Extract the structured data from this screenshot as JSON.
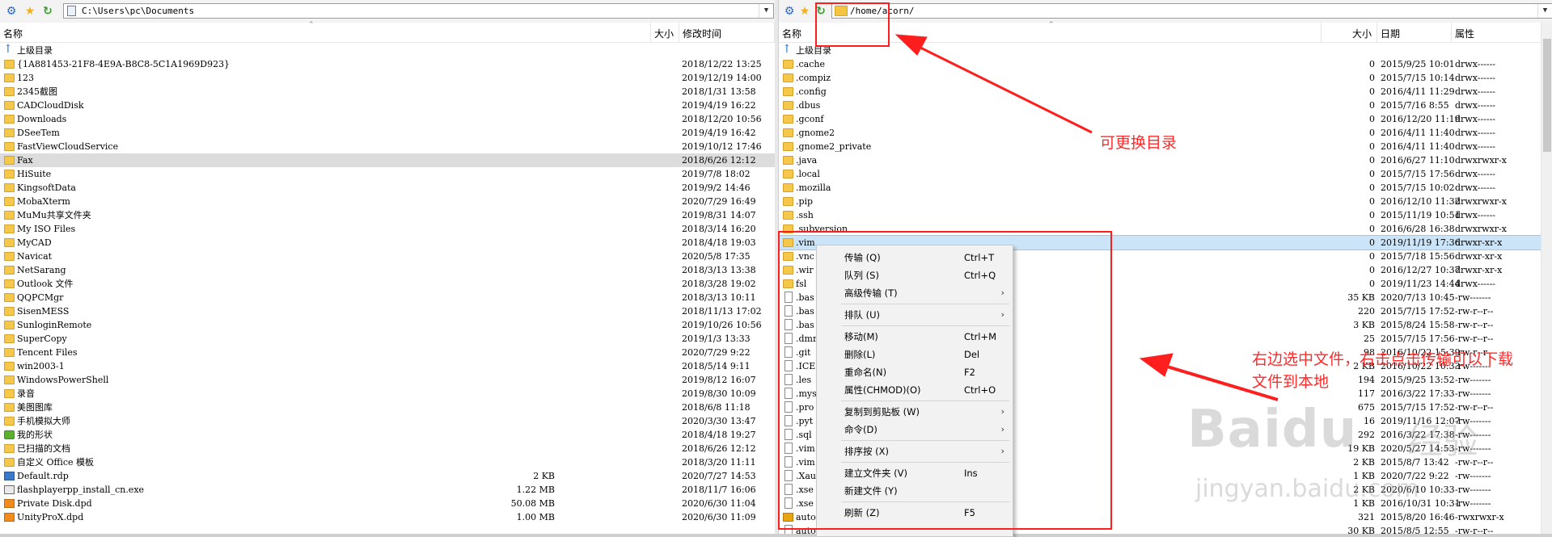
{
  "left": {
    "path": "C:\\Users\\pc\\Documents",
    "columns": {
      "name": "名称",
      "size": "大小",
      "date": "修改时间"
    },
    "rows": [
      {
        "icon": "up",
        "name": "上级目录",
        "size": "",
        "date": ""
      },
      {
        "icon": "folder",
        "name": "{1A881453-21F8-4E9A-B8C8-5C1A1969D923}",
        "size": "",
        "date": "2018/12/22 13:25"
      },
      {
        "icon": "folder",
        "name": "123",
        "size": "",
        "date": "2019/12/19 14:00"
      },
      {
        "icon": "folder",
        "name": "2345截图",
        "size": "",
        "date": "2018/1/31 13:58"
      },
      {
        "icon": "folder",
        "name": "CADCloudDisk",
        "size": "",
        "date": "2019/4/19 16:22"
      },
      {
        "icon": "folder",
        "name": "Downloads",
        "size": "",
        "date": "2018/12/20 10:56"
      },
      {
        "icon": "folder",
        "name": "DSeeTem",
        "size": "",
        "date": "2019/4/19 16:42"
      },
      {
        "icon": "folder",
        "name": "FastViewCloudService",
        "size": "",
        "date": "2019/10/12 17:46"
      },
      {
        "icon": "folder",
        "name": "Fax",
        "size": "",
        "date": "2018/6/26 12:12",
        "selected": true
      },
      {
        "icon": "folder",
        "name": "HiSuite",
        "size": "",
        "date": "2019/7/8 18:02"
      },
      {
        "icon": "folder",
        "name": "KingsoftData",
        "size": "",
        "date": "2019/9/2 14:46"
      },
      {
        "icon": "folder",
        "name": "MobaXterm",
        "size": "",
        "date": "2020/7/29 16:49"
      },
      {
        "icon": "folder",
        "name": "MuMu共享文件夹",
        "size": "",
        "date": "2019/8/31 14:07"
      },
      {
        "icon": "folder",
        "name": "My ISO Files",
        "size": "",
        "date": "2018/3/14 16:20"
      },
      {
        "icon": "folder",
        "name": "MyCAD",
        "size": "",
        "date": "2018/4/18 19:03"
      },
      {
        "icon": "folder",
        "name": "Navicat",
        "size": "",
        "date": "2020/5/8 17:35"
      },
      {
        "icon": "folder",
        "name": "NetSarang",
        "size": "",
        "date": "2018/3/13 13:38"
      },
      {
        "icon": "folder",
        "name": "Outlook 文件",
        "size": "",
        "date": "2018/3/28 19:02"
      },
      {
        "icon": "folder",
        "name": "QQPCMgr",
        "size": "",
        "date": "2018/3/13 10:11"
      },
      {
        "icon": "folder",
        "name": "SisenMESS",
        "size": "",
        "date": "2018/11/13 17:02"
      },
      {
        "icon": "folder",
        "name": "SunloginRemote",
        "size": "",
        "date": "2019/10/26 10:56"
      },
      {
        "icon": "folder",
        "name": "SuperCopy",
        "size": "",
        "date": "2019/1/3 13:33"
      },
      {
        "icon": "folder",
        "name": "Tencent Files",
        "size": "",
        "date": "2020/7/29 9:22"
      },
      {
        "icon": "folder",
        "name": "win2003-1",
        "size": "",
        "date": "2018/5/14 9:11"
      },
      {
        "icon": "folder",
        "name": "WindowsPowerShell",
        "size": "",
        "date": "2019/8/12 16:07"
      },
      {
        "icon": "folder",
        "name": "录音",
        "size": "",
        "date": "2019/8/30 10:09"
      },
      {
        "icon": "folder",
        "name": "美图图库",
        "size": "",
        "date": "2018/6/8 11:18"
      },
      {
        "icon": "folder",
        "name": "手机模拟大师",
        "size": "",
        "date": "2020/3/30 13:47"
      },
      {
        "icon": "shape",
        "name": "我的形状",
        "size": "",
        "date": "2018/4/18 19:27"
      },
      {
        "icon": "folder",
        "name": "已扫描的文档",
        "size": "",
        "date": "2018/6/26 12:12"
      },
      {
        "icon": "folder",
        "name": "自定义 Office 模板",
        "size": "",
        "date": "2018/3/20 11:11"
      },
      {
        "icon": "rdp",
        "name": "Default.rdp",
        "size": "2 KB",
        "date": "2020/7/27 14:53"
      },
      {
        "icon": "exe",
        "name": "flashplayerpp_install_cn.exe",
        "size": "1.22 MB",
        "date": "2018/11/7 16:06"
      },
      {
        "icon": "dpd",
        "name": "Private Disk.dpd",
        "size": "50.08 MB",
        "date": "2020/6/30 11:04"
      },
      {
        "icon": "dpd",
        "name": "UnityProX.dpd",
        "size": "1.00 MB",
        "date": "2020/6/30 11:09"
      }
    ]
  },
  "right": {
    "path": "/home/acorn/",
    "columns": {
      "name": "名称",
      "size": "大小",
      "date": "日期",
      "perm": "属性"
    },
    "rows": [
      {
        "icon": "up",
        "name": "上级目录",
        "size": "",
        "date": "",
        "perm": ""
      },
      {
        "icon": "folder",
        "name": ".cache",
        "size": "0",
        "date": "2015/9/25 10:01",
        "perm": "drwx------"
      },
      {
        "icon": "folder",
        "name": ".compiz",
        "size": "0",
        "date": "2015/7/15 10:14",
        "perm": "drwx------"
      },
      {
        "icon": "folder",
        "name": ".config",
        "size": "0",
        "date": "2016/4/11 11:29",
        "perm": "drwx------"
      },
      {
        "icon": "folder",
        "name": ".dbus",
        "size": "0",
        "date": "2015/7/16 8:55",
        "perm": "drwx------"
      },
      {
        "icon": "folder",
        "name": ".gconf",
        "size": "0",
        "date": "2016/12/20 11:19",
        "perm": "drwx------"
      },
      {
        "icon": "folder",
        "name": ".gnome2",
        "size": "0",
        "date": "2016/4/11 11:40",
        "perm": "drwx------"
      },
      {
        "icon": "folder",
        "name": ".gnome2_private",
        "size": "0",
        "date": "2016/4/11 11:40",
        "perm": "drwx------"
      },
      {
        "icon": "folder",
        "name": ".java",
        "size": "0",
        "date": "2016/6/27 11:10",
        "perm": "drwxrwxr-x"
      },
      {
        "icon": "folder",
        "name": ".local",
        "size": "0",
        "date": "2015/7/15 17:56",
        "perm": "drwx------"
      },
      {
        "icon": "folder",
        "name": ".mozilla",
        "size": "0",
        "date": "2015/7/15 10:02",
        "perm": "drwx------"
      },
      {
        "icon": "folder",
        "name": ".pip",
        "size": "0",
        "date": "2016/12/10 11:32",
        "perm": "drwxrwxr-x"
      },
      {
        "icon": "folder",
        "name": ".ssh",
        "size": "0",
        "date": "2015/11/19 10:51",
        "perm": "drwx------"
      },
      {
        "icon": "folder",
        "name": ".subversion",
        "size": "0",
        "date": "2016/6/28 16:38",
        "perm": "drwxrwxr-x"
      },
      {
        "icon": "folder",
        "name": ".vim",
        "size": "0",
        "date": "2019/11/19 17:36",
        "perm": "drwxr-xr-x",
        "selected": true
      },
      {
        "icon": "folder",
        "name": ".vnc",
        "size": "0",
        "date": "2015/7/18 15:56",
        "perm": "drwxr-xr-x"
      },
      {
        "icon": "folder",
        "name": ".wir",
        "size": "0",
        "date": "2016/12/27 10:37",
        "perm": "drwxr-xr-x"
      },
      {
        "icon": "folder",
        "name": "fsl",
        "size": "0",
        "date": "2019/11/23 14:44",
        "perm": "drwx------"
      },
      {
        "icon": "file",
        "name": ".bas",
        "size": "35 KB",
        "date": "2020/7/13 10:45",
        "perm": "-rw-------"
      },
      {
        "icon": "file",
        "name": ".bas",
        "size": "220",
        "date": "2015/7/15 17:52",
        "perm": "-rw-r--r--"
      },
      {
        "icon": "file",
        "name": ".bas",
        "size": "3 KB",
        "date": "2015/8/24 15:58",
        "perm": "-rw-r--r--"
      },
      {
        "icon": "file",
        "name": ".dmr",
        "size": "25",
        "date": "2015/7/15 17:56",
        "perm": "-rw-r--r--"
      },
      {
        "icon": "file",
        "name": ".git",
        "size": "98",
        "date": "2016/10/22 15:39",
        "perm": "-rw-r--r--"
      },
      {
        "icon": "file",
        "name": ".ICE",
        "size": "2 KB",
        "date": "2016/10/22 10:33",
        "perm": "-rw-------"
      },
      {
        "icon": "file",
        "name": ".les",
        "size": "194",
        "date": "2015/9/25 13:52",
        "perm": "-rw-------"
      },
      {
        "icon": "file",
        "name": ".mys",
        "size": "117",
        "date": "2016/3/22 17:33",
        "perm": "-rw-------"
      },
      {
        "icon": "file",
        "name": ".pro",
        "size": "675",
        "date": "2015/7/15 17:52",
        "perm": "-rw-r--r--"
      },
      {
        "icon": "file",
        "name": ".pyt",
        "size": "16",
        "date": "2019/11/16 12:07",
        "perm": "-rw-------"
      },
      {
        "icon": "file",
        "name": ".sql",
        "size": "292",
        "date": "2016/3/22 17:38",
        "perm": "-rw-------"
      },
      {
        "icon": "file",
        "name": ".vim",
        "size": "19 KB",
        "date": "2020/5/27 14:53",
        "perm": "-rw-------"
      },
      {
        "icon": "file",
        "name": ".vim",
        "size": "2 KB",
        "date": "2015/8/7 13:42",
        "perm": "-rw-r--r--"
      },
      {
        "icon": "file",
        "name": ".Xau",
        "size": "1 KB",
        "date": "2020/7/22 9:22",
        "perm": "-rw-------"
      },
      {
        "icon": "file",
        "name": ".xse",
        "size": "2 KB",
        "date": "2020/6/10 10:33",
        "perm": "-rw-------"
      },
      {
        "icon": "file",
        "name": ".xse",
        "size": "1 KB",
        "date": "2016/10/31 10:31",
        "perm": "-rw-------"
      },
      {
        "icon": "sh",
        "name": "auto",
        "size": "321",
        "date": "2015/8/20 16:46",
        "perm": "-rwxrwxr-x"
      },
      {
        "icon": "file",
        "name": "auto",
        "size": "30 KB",
        "date": "2015/8/5 12:55",
        "perm": "-rw-r--r--"
      }
    ]
  },
  "context_menu": {
    "items": [
      {
        "label": "传输 (Q)",
        "shortcut": "Ctrl+T",
        "submenu": false
      },
      {
        "label": "队列 (S)",
        "shortcut": "Ctrl+Q",
        "submenu": false
      },
      {
        "label": "高级传输 (T)",
        "shortcut": "",
        "submenu": true
      },
      {
        "sep": true
      },
      {
        "label": "排队 (U)",
        "shortcut": "",
        "submenu": true
      },
      {
        "sep": true
      },
      {
        "label": "移动(M)",
        "shortcut": "Ctrl+M",
        "submenu": false
      },
      {
        "label": "删除(L)",
        "shortcut": "Del",
        "submenu": false
      },
      {
        "label": "重命名(N)",
        "shortcut": "F2",
        "submenu": false
      },
      {
        "label": "属性(CHMOD)(O)",
        "shortcut": "Ctrl+O",
        "submenu": false
      },
      {
        "sep": true
      },
      {
        "label": "复制到剪贴板 (W)",
        "shortcut": "",
        "submenu": true
      },
      {
        "label": "命令(D)",
        "shortcut": "",
        "submenu": true
      },
      {
        "sep": true
      },
      {
        "label": "排序按 (X)",
        "shortcut": "",
        "submenu": true
      },
      {
        "sep": true
      },
      {
        "label": "建立文件夹 (V)",
        "shortcut": "Ins",
        "submenu": false
      },
      {
        "label": "新建文件 (Y)",
        "shortcut": "",
        "submenu": false
      },
      {
        "sep": true
      },
      {
        "label": "刷新 (Z)",
        "shortcut": "F5",
        "submenu": false
      }
    ]
  },
  "annotations": {
    "path_note": "可更换目录",
    "menu_note_line1": "右边选中文件，右击点击传输可以下载",
    "menu_note_line2": "文件到本地"
  },
  "watermark": {
    "brand": "Baidu",
    "cn": "经验",
    "url": "jingyan.baidu.com"
  },
  "colors": {
    "annotation": "#ff1e1e",
    "selection": "#cce4f7",
    "folder": "#f5c84c"
  }
}
